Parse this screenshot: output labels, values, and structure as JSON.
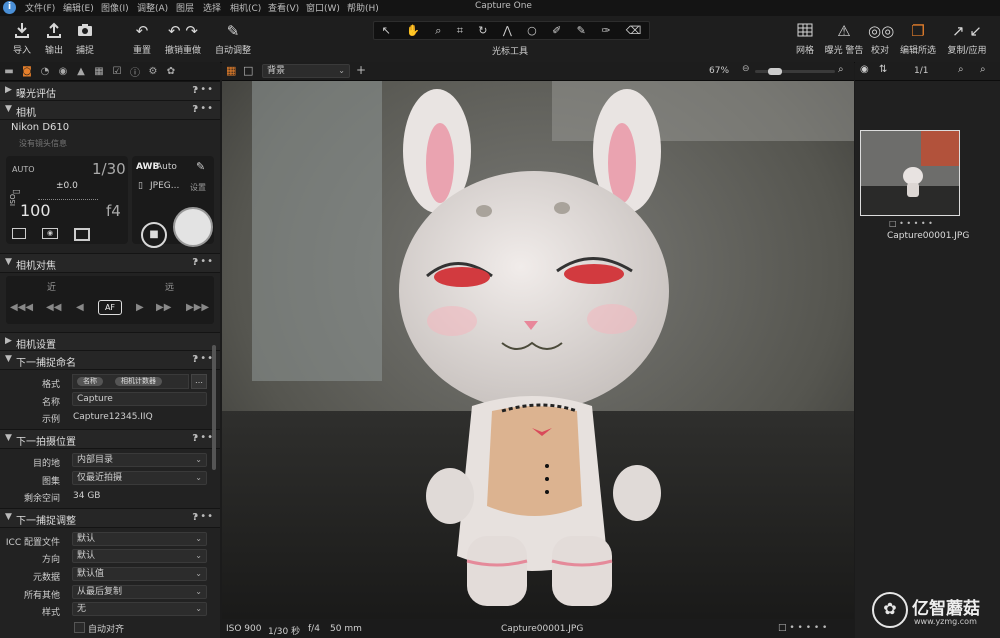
{
  "app": {
    "title": "Capture One",
    "logo": "i"
  },
  "menu": [
    "文件(F)",
    "编辑(E)",
    "图像(I)",
    "调整(A)",
    "图层",
    "选择",
    "相机(C)",
    "查看(V)",
    "窗口(W)",
    "帮助(H)"
  ],
  "toolbar": {
    "left": [
      {
        "icon": "import-icon",
        "label": "导入"
      },
      {
        "icon": "export-icon",
        "label": "输出"
      },
      {
        "icon": "capture-icon",
        "label": "捕捉"
      },
      {
        "icon": "reset-icon",
        "label": "重置"
      },
      {
        "icon": "undo-redo-icon",
        "label": "撤销重做"
      },
      {
        "icon": "auto-adjust-icon",
        "label": "自动调整"
      }
    ],
    "cursor_tools_label": "光标工具",
    "right": [
      {
        "icon": "grid-icon",
        "label": "网格"
      },
      {
        "icon": "exposure-warning-icon",
        "label": "曝光 警告"
      },
      {
        "icon": "proof-icon",
        "label": "校对"
      },
      {
        "icon": "edit-selected-icon",
        "label": "编辑所选"
      },
      {
        "icon": "copy-apply-icon",
        "label": "复制/应用"
      }
    ]
  },
  "left_panel": {
    "sections": {
      "exposure_eval": "曝光评估",
      "camera": "相机",
      "camera_focus": "相机对焦",
      "camera_settings": "相机设置",
      "next_capture_naming": "下一捕捉命名",
      "next_capture_location": "下一拍摄位置",
      "next_capture_adjust": "下一捕捉调整"
    },
    "camera": {
      "model": "Nikon D610",
      "lens": "没有镜头信息",
      "mode": "AUTO",
      "shutter": "1/30",
      "ev": "±0.0",
      "iso_label": "ISO",
      "iso": "100",
      "aperture": "f4",
      "wb_label": "AWB",
      "wb_value": "Auto",
      "format": "JPEG...",
      "settings_label": "设置"
    },
    "focus": {
      "near": "近",
      "far": "远",
      "af": "AF"
    },
    "naming": {
      "format_label": "格式",
      "format_tokens": [
        "名称",
        "相机计数器"
      ],
      "name_label": "名称",
      "name_value": "Capture",
      "example_label": "示例",
      "example_value": "Capture12345.IIQ"
    },
    "location": {
      "dest_label": "目的地",
      "dest_value": "内部目录",
      "album_label": "图集",
      "album_value": "仅最近拍摄",
      "space_label": "剩余空间",
      "space_value": "34 GB"
    },
    "adjust": {
      "icc_label": "ICC 配置文件",
      "icc_value": "默认",
      "orient_label": "方向",
      "orient_value": "默认",
      "meta_label": "元数据",
      "meta_value": "默认值",
      "others_label": "所有其他",
      "others_value": "从最后复制",
      "style_label": "样式",
      "style_value": "无",
      "auto_align": "自动对齐"
    }
  },
  "viewer": {
    "background_dropdown": "背景",
    "zoom": "67%",
    "zoom_fraction": 0.2,
    "status": {
      "iso": "ISO 900",
      "shutter": "1/30 秒",
      "aperture": "f/4",
      "focal": "50 mm",
      "filename": "Capture00001.JPG"
    }
  },
  "browser": {
    "counter": "1/1",
    "thumb_name": "Capture00001.JPG"
  },
  "watermark": {
    "text": "亿智蘑菇",
    "url": "www.yzmg.com"
  }
}
